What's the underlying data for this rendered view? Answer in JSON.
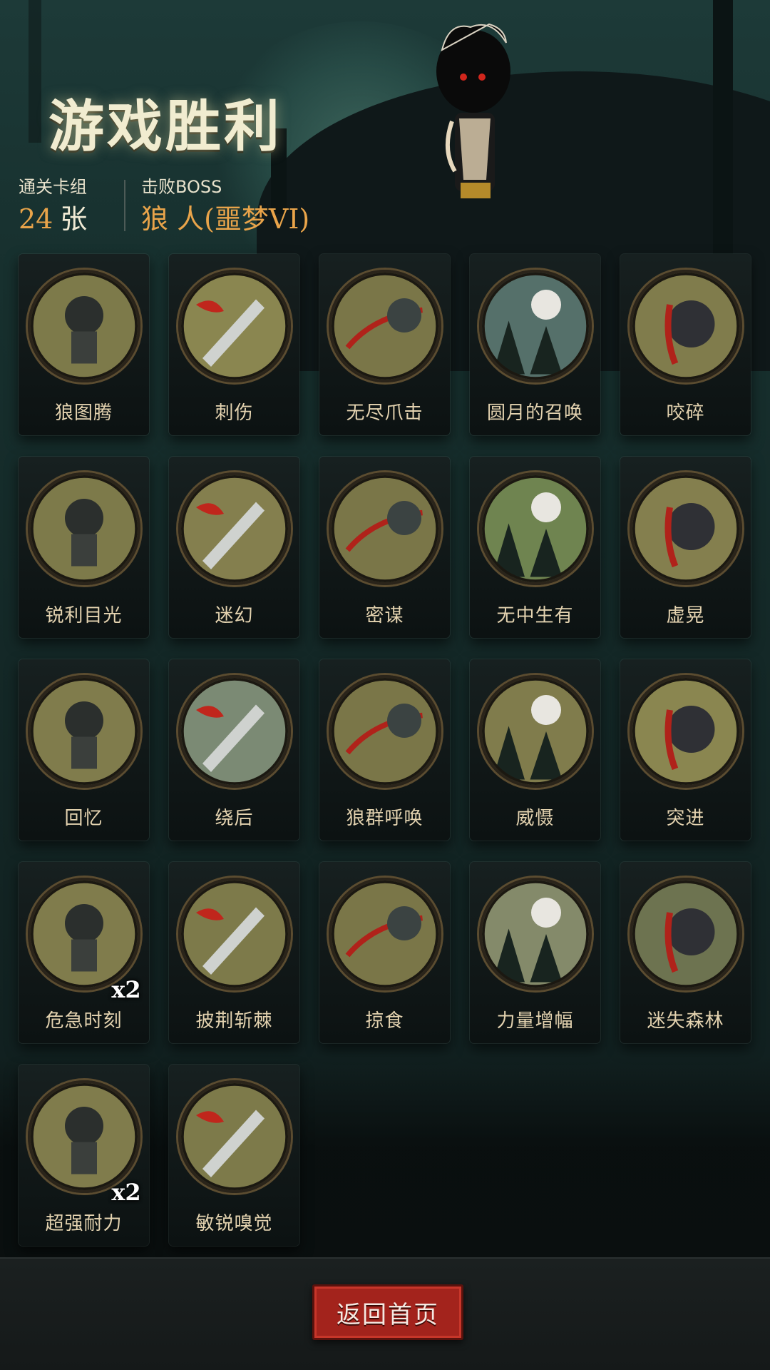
{
  "header": {
    "title": "游戏胜利",
    "deck": {
      "label": "通关卡组",
      "value": "24",
      "unit": "张"
    },
    "boss": {
      "label": "击败BOSS",
      "name": "狼 人(噩梦VI)"
    }
  },
  "cards": [
    {
      "name": "狼图腾",
      "art": "wolf-totem-icon",
      "color": "#7d7a4a"
    },
    {
      "name": "刺伤",
      "art": "dagger-stab-icon",
      "color": "#8a8650"
    },
    {
      "name": "无尽爪击",
      "art": "claw-strike-icon",
      "color": "#7a7648"
    },
    {
      "name": "圆月的召唤",
      "art": "full-moon-icon",
      "color": "#55706a"
    },
    {
      "name": "咬碎",
      "art": "werewolf-bite-icon",
      "color": "#807c4c"
    },
    {
      "name": "锐利目光",
      "art": "wolf-glare-icon",
      "color": "#7d7a4a"
    },
    {
      "name": "迷幻",
      "art": "witch-icon",
      "color": "#847f4e"
    },
    {
      "name": "密谋",
      "art": "hooded-cultists-icon",
      "color": "#7a7648"
    },
    {
      "name": "无中生有",
      "art": "green-burst-icon",
      "color": "#6f8450"
    },
    {
      "name": "虚晃",
      "art": "boxer-icon",
      "color": "#847f4e"
    },
    {
      "name": "回忆",
      "art": "old-man-icon",
      "color": "#807c4c"
    },
    {
      "name": "绕后",
      "art": "skeleton-ambush-icon",
      "color": "#7b8a74"
    },
    {
      "name": "狼群呼唤",
      "art": "wolf-pack-icon",
      "color": "#7a7648"
    },
    {
      "name": "威慑",
      "art": "bear-icon",
      "color": "#807c4c"
    },
    {
      "name": "突进",
      "art": "werewolf-leap-icon",
      "color": "#8a8650"
    },
    {
      "name": "危急时刻",
      "art": "boy-critical-icon",
      "color": "#807c4c",
      "badge": "x2"
    },
    {
      "name": "披荆斩棘",
      "art": "axe-thorns-icon",
      "color": "#7d7a4a"
    },
    {
      "name": "掠食",
      "art": "werewolf-prowl-icon",
      "color": "#7a7648"
    },
    {
      "name": "力量增幅",
      "art": "log-lift-icon",
      "color": "#848a6a"
    },
    {
      "name": "迷失森林",
      "art": "lost-forest-icon",
      "color": "#6d7350"
    },
    {
      "name": "超强耐力",
      "art": "boy-endurance-icon",
      "color": "#807c4c",
      "badge": "x2"
    },
    {
      "name": "敏锐嗅觉",
      "art": "wolf-snarl-icon",
      "color": "#7d7a4a"
    }
  ],
  "footer": {
    "home_label": "返回首页"
  }
}
